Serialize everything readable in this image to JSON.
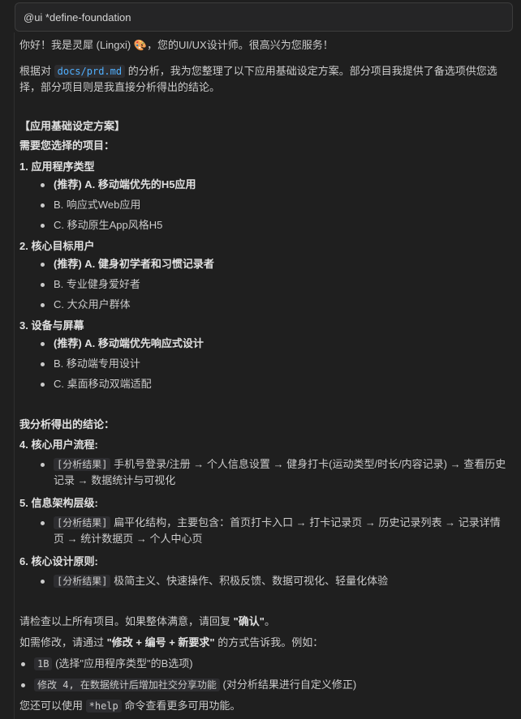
{
  "input": {
    "value": "@ui *define-foundation"
  },
  "greeting": "你好！我是灵犀 (Lingxi) 🎨，您的UI/UX设计师。很高兴为您服务！",
  "intro": {
    "before": "根据对 ",
    "code": "docs/prd.md",
    "after": " 的分析，我为您整理了以下应用基础设定方案。部分项目我提供了备选项供您选择，部分项目则是我直接分析得出的结论。"
  },
  "plan_title": "【应用基础设定方案】",
  "choose_heading": "需要您选择的项目：",
  "sections": [
    {
      "title": "1. 应用程序类型",
      "options": [
        "(推荐) A. 移动端优先的H5应用",
        "B. 响应式Web应用",
        "C. 移动原生App风格H5"
      ]
    },
    {
      "title": "2. 核心目标用户",
      "options": [
        "(推荐) A. 健身初学者和习惯记录者",
        "B. 专业健身爱好者",
        "C. 大众用户群体"
      ]
    },
    {
      "title": "3. 设备与屏幕",
      "options": [
        "(推荐) A. 移动端优先响应式设计",
        "B. 移动端专用设计",
        "C. 桌面移动双端适配"
      ]
    }
  ],
  "conclusion_heading": "我分析得出的结论：",
  "conclusions": [
    {
      "title": "4. 核心用户流程:",
      "tag": "[分析结果]",
      "text": " 手机号登录/注册 → 个人信息设置 → 健身打卡(运动类型/时长/内容记录) → 查看历史记录 → 数据统计与可视化"
    },
    {
      "title": "5. 信息架构层级:",
      "tag": "[分析结果]",
      "text": " 扁平化结构，主要包含：首页打卡入口 → 打卡记录页 → 历史记录列表 → 记录详情页 → 统计数据页 → 个人中心页"
    },
    {
      "title": "6. 核心设计原则:",
      "tag": "[分析结果]",
      "text": " 极简主义、快速操作、积极反馈、数据可视化、轻量化体验"
    }
  ],
  "confirm": {
    "before": "请检查以上所有项目。如果整体满意，请回复 ",
    "bold": "\"确认\"",
    "after": "。"
  },
  "modify": {
    "before": "如需修改，请通过 ",
    "bold": "\"修改 + 编号 + 新要求\"",
    "after": " 的方式告诉我。例如："
  },
  "examples": [
    {
      "code": "1B",
      "text": " (选择\"应用程序类型\"的B选项)"
    },
    {
      "code": "修改 4, 在数据统计后增加社交分享功能",
      "text": " (对分析结果进行自定义修正)"
    }
  ],
  "help": {
    "before": "您还可以使用 ",
    "code": "*help",
    "after": " 命令查看更多可用功能。"
  }
}
